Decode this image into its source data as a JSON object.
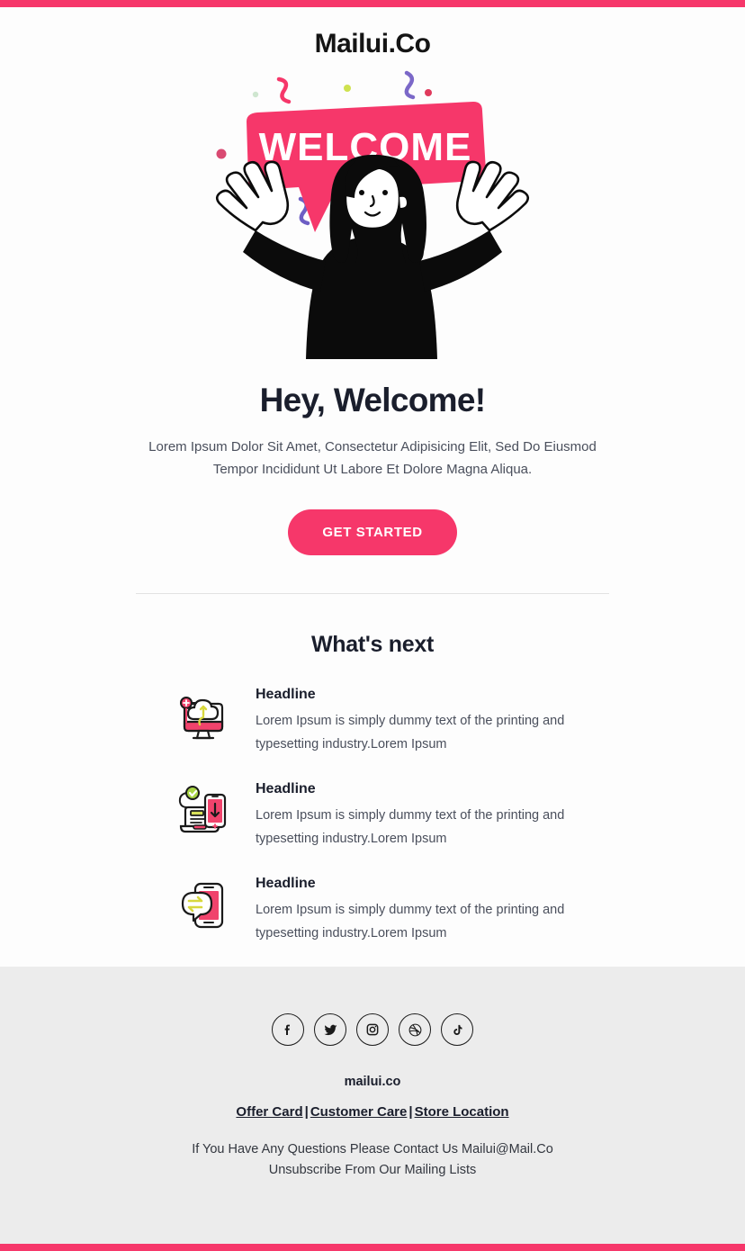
{
  "brand": {
    "logo": "Mailui.Co",
    "accent_color": "#f6376a",
    "dark_color": "#1a1e2c",
    "footer_bg": "#ececec"
  },
  "hero": {
    "banner_text": "WELCOME",
    "illustration": "person-with-raised-arms-illustration"
  },
  "main": {
    "headline": "Hey, Welcome!",
    "subcopy": "Lorem Ipsum Dolor Sit Amet, Consectetur Adipisicing Elit, Sed Do Eiusmod Tempor Incididunt Ut Labore Et Dolore Magna Aliqua.",
    "cta_label": "GET STARTED"
  },
  "whats_next": {
    "title": "What's next",
    "items": [
      {
        "icon": "monitor-cloud-sync-icon",
        "title": "Headline",
        "body": "Lorem Ipsum is simply dummy text of the printing and typesetting industry.Lorem Ipsum"
      },
      {
        "icon": "laptop-phone-download-icon",
        "title": "Headline",
        "body": "Lorem Ipsum is simply dummy text of the printing and typesetting industry.Lorem Ipsum"
      },
      {
        "icon": "phone-transfer-message-icon",
        "title": "Headline",
        "body": "Lorem Ipsum is simply dummy text of the printing and typesetting industry.Lorem Ipsum"
      }
    ]
  },
  "footer": {
    "socials": [
      {
        "name": "facebook-icon",
        "label": "Facebook"
      },
      {
        "name": "twitter-icon",
        "label": "Twitter"
      },
      {
        "name": "instagram-icon",
        "label": "Instagram"
      },
      {
        "name": "dribbble-icon",
        "label": "Dribbble"
      },
      {
        "name": "tiktok-icon",
        "label": "TikTok"
      }
    ],
    "brand": "mailui.co",
    "links": [
      {
        "label": "Offer Card"
      },
      {
        "label": "Customer Care"
      },
      {
        "label": "Store Location"
      }
    ],
    "separator": "|",
    "contact_line": "If You Have Any Questions Please Contact Us Mailui@Mail.Co",
    "unsubscribe_line": "Unsubscribe From Our Mailing Lists"
  }
}
